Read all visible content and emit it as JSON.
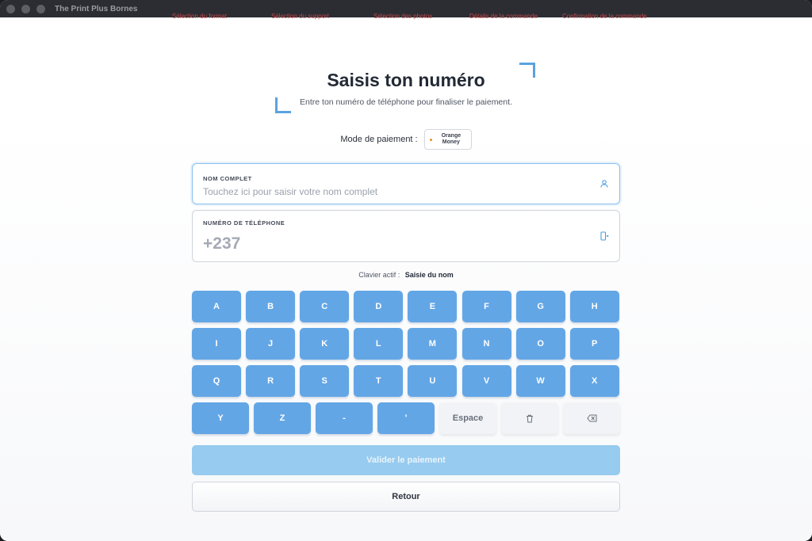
{
  "window": {
    "title": "The Print Plus Bornes"
  },
  "steps": [
    "Sélection du format",
    "Sélection du support",
    "Sélection des photos",
    "Détails de la commande",
    "Confirmation de la commande"
  ],
  "page": {
    "title": "Saisis ton numéro",
    "subtitle": "Entre ton numéro de téléphone pour finaliser le paiement."
  },
  "payment": {
    "label": "Mode de paiement :",
    "method_line1": "Orange",
    "method_line2": "Money"
  },
  "fields": {
    "name": {
      "label": "NOM COMPLET",
      "placeholder": "Touchez ici pour saisir votre nom complet",
      "icon": "user-icon"
    },
    "phone": {
      "label": "NUMÉRO DE TÉLÉPHONE",
      "value": "+237",
      "icon": "phone-icon"
    }
  },
  "keyboard_status": {
    "label": "Clavier actif :",
    "value": "Saisie du nom"
  },
  "keyboard": {
    "rows": [
      [
        "A",
        "B",
        "C",
        "D",
        "E",
        "F",
        "G",
        "H"
      ],
      [
        "I",
        "J",
        "K",
        "L",
        "M",
        "N",
        "O",
        "P"
      ],
      [
        "Q",
        "R",
        "S",
        "T",
        "U",
        "V",
        "W",
        "X"
      ]
    ],
    "last_row": [
      "Y",
      "Z",
      "-",
      "'"
    ],
    "space_label": "Espace",
    "clear_icon": "trash-icon",
    "backspace_icon": "backspace-icon"
  },
  "actions": {
    "validate": "Valider le paiement",
    "back": "Retour"
  },
  "colors": {
    "accent": "#63a6e6",
    "accent_disabled": "#97cbef",
    "title": "#232a36",
    "orange": "#f08a24"
  }
}
